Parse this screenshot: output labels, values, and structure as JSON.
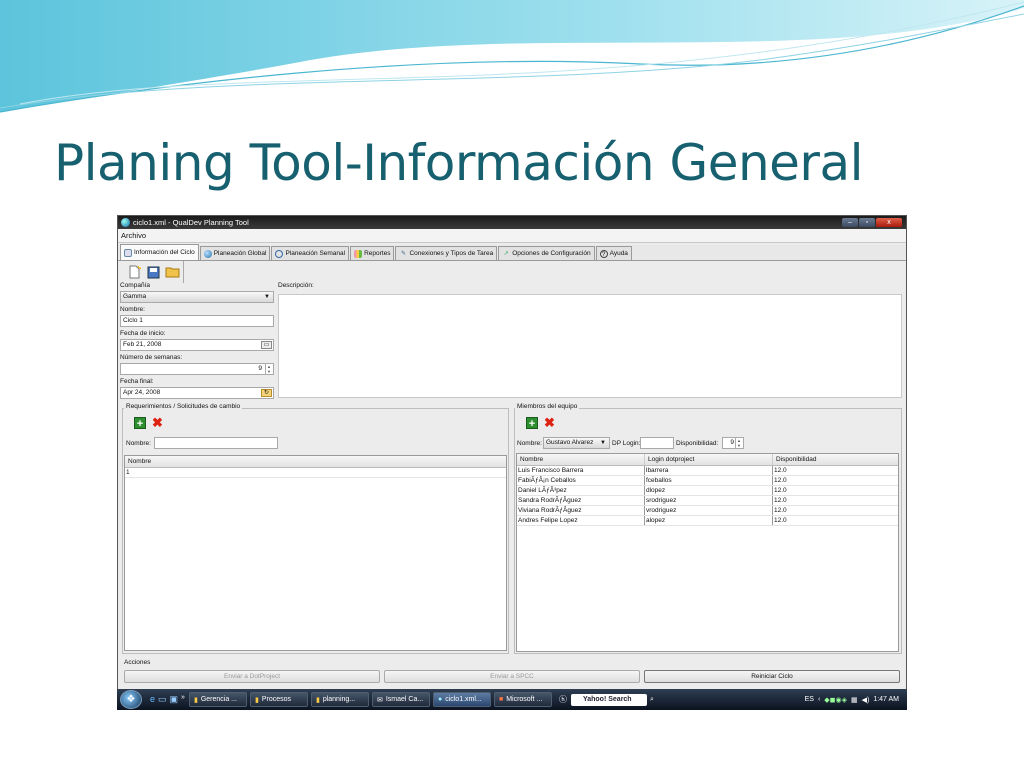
{
  "slide": {
    "title": "Planing Tool-Información General"
  },
  "window": {
    "title": "ciclo1.xml - QualDev Planning Tool",
    "minimize_glyph": "–",
    "maximize_glyph": "▫",
    "close_glyph": "x"
  },
  "menu": {
    "archivo": "Archivo"
  },
  "tabs": [
    {
      "label": "Información del Ciclo",
      "icon": "calendar-icon"
    },
    {
      "label": "Planeación Global",
      "icon": "globe-icon"
    },
    {
      "label": "Planeación Semanal",
      "icon": "week-icon"
    },
    {
      "label": "Reportes",
      "icon": "bar-chart-icon"
    },
    {
      "label": "Conexiones y  Tipos de Tarea",
      "icon": "pencil-icon"
    },
    {
      "label": "Opciones de Configuración",
      "icon": "settings-icon"
    },
    {
      "label": "Ayuda",
      "icon": "help-icon"
    }
  ],
  "form": {
    "compania_label": "Compañía",
    "compania_value": "Gamma",
    "nombre_label": "Nombre:",
    "nombre_value": "Ciclo 1",
    "fecha_inicio_label": "Fecha de inicio:",
    "fecha_inicio_value": "Feb 21, 2008",
    "semanas_label": "Número de semanas:",
    "semanas_value": "9",
    "fecha_final_label": "Fecha final:",
    "fecha_final_value": "Apr 24, 2008",
    "descripcion_label": "Descripción:"
  },
  "requerimientos": {
    "title": "Requerimientos / Solicitudes de cambio",
    "nombre_label": "Nombre:",
    "column": "Nombre",
    "rows": [
      "1"
    ]
  },
  "miembros": {
    "title": "Miembros del equipo",
    "nombre_label": "Nombre:",
    "nombre_value": "Gustavo Alvarez",
    "dp_login_label": "DP Login:",
    "disponibilidad_label": "Disponibilidad:",
    "disponibilidad_value": "9",
    "columns": [
      "Nombre",
      "Login dotproject",
      "Disponibilidad"
    ],
    "rows": [
      {
        "nombre": "Luis Francisco Barrera",
        "login": "lbarrera",
        "disp": "12.0"
      },
      {
        "nombre": "FabiÃƒÂ¡n Ceballos",
        "login": "fceballos",
        "disp": "12.0"
      },
      {
        "nombre": "Daniel LÃƒÂ³pez",
        "login": "dlopez",
        "disp": "12.0"
      },
      {
        "nombre": "Sandra RodrÃƒÂ­guez",
        "login": "srodriguez",
        "disp": "12.0"
      },
      {
        "nombre": "Viviana RodrÃƒÂ­guez",
        "login": "vrodriguez",
        "disp": "12.0"
      },
      {
        "nombre": "Andres Felipe Lopez",
        "login": "alopez",
        "disp": "12.0"
      }
    ]
  },
  "acciones": {
    "title": "Acciones",
    "enviar_dotproject": "Enviar a DotProject",
    "enviar_spcc": "Enviar a SPCC",
    "reiniciar": "Reiniciar Ciclo"
  },
  "taskbar": {
    "items": [
      {
        "label": "Gerencia ...",
        "active": false
      },
      {
        "label": "Procesos",
        "active": false
      },
      {
        "label": "planning...",
        "active": false
      },
      {
        "label": "Ismael Ca...",
        "active": false
      },
      {
        "label": "ciclo1.xml...",
        "active": true
      },
      {
        "label": "Microsoft ...",
        "active": false
      }
    ],
    "search_placeholder": "Yahoo! Search",
    "lang": "ES",
    "time": "1:47 AM"
  }
}
